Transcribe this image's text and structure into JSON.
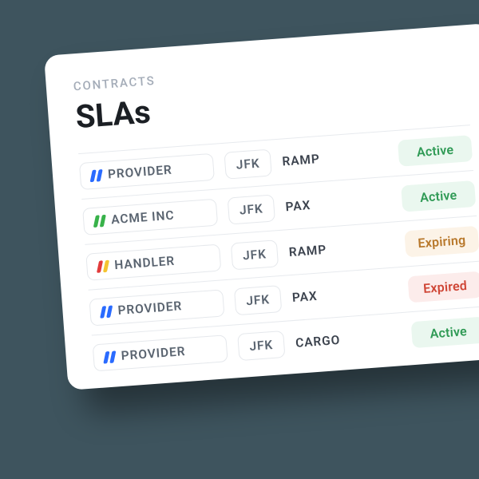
{
  "section_label": "CONTRACTS",
  "title": "SLAs",
  "status_labels": {
    "active": "Active",
    "expiring": "Expiring",
    "expired": "Expired"
  },
  "rows": [
    {
      "company": "PROVIDER",
      "colors": [
        "#2a6bff",
        "#2a6bff"
      ],
      "code": "JFK",
      "type": "RAMP",
      "status": "active"
    },
    {
      "company": "ACME INC",
      "colors": [
        "#38b24a",
        "#38b24a"
      ],
      "code": "JFK",
      "type": "PAX",
      "status": "active"
    },
    {
      "company": "HANDLER",
      "colors": [
        "#e23b3b",
        "#f4c430"
      ],
      "code": "JFK",
      "type": "RAMP",
      "status": "expiring"
    },
    {
      "company": "PROVIDER",
      "colors": [
        "#2a6bff",
        "#2a6bff"
      ],
      "code": "JFK",
      "type": "PAX",
      "status": "expired"
    },
    {
      "company": "PROVIDER",
      "colors": [
        "#2a6bff",
        "#2a6bff"
      ],
      "code": "JFK",
      "type": "CARGO",
      "status": "active"
    }
  ]
}
